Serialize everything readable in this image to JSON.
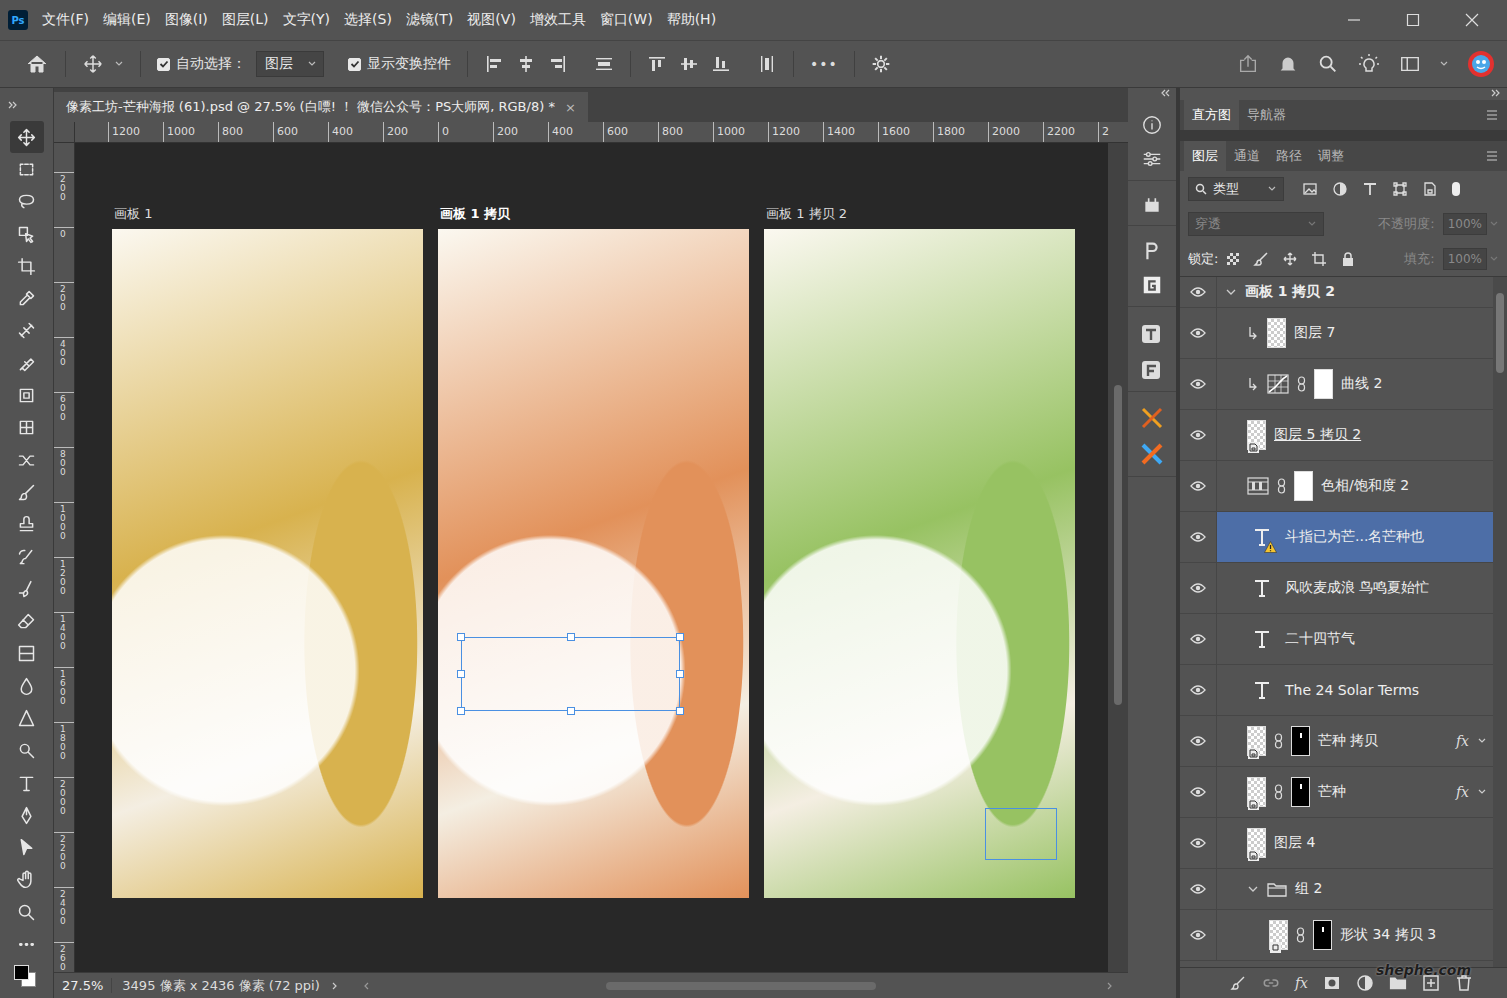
{
  "app": {
    "logo": "Ps"
  },
  "menu": [
    "文件(F)",
    "编辑(E)",
    "图像(I)",
    "图层(L)",
    "文字(Y)",
    "选择(S)",
    "滤镜(T)",
    "视图(V)",
    "增效工具",
    "窗口(W)",
    "帮助(H)"
  ],
  "options_bar": {
    "auto_select": {
      "label": "自动选择：",
      "checked": true
    },
    "target": "图层",
    "show_transform": {
      "label": "显示变换控件",
      "checked": true
    },
    "more": "•••"
  },
  "document_tab": {
    "title": "像素工坊-芒种海报 (61).psd @ 27.5% (白嘌! ！ 微信公众号：PS大师网, RGB/8) *",
    "close": "×"
  },
  "tools": [
    {
      "kind": "move",
      "selected": true
    },
    {
      "kind": "marquee",
      "selected": false
    },
    {
      "kind": "lasso",
      "selected": false
    },
    {
      "kind": "object-select",
      "selected": false
    },
    {
      "kind": "crop",
      "selected": false
    },
    {
      "kind": "eyedropper",
      "selected": false
    },
    {
      "kind": "spot-heal",
      "selected": false
    },
    {
      "kind": "heal",
      "selected": false
    },
    {
      "kind": "patch",
      "selected": false
    },
    {
      "kind": "pattern",
      "selected": false
    },
    {
      "kind": "content-move",
      "selected": false
    },
    {
      "kind": "brush",
      "selected": false
    },
    {
      "kind": "stamp",
      "selected": false
    },
    {
      "kind": "history-brush",
      "selected": false
    },
    {
      "kind": "mixer",
      "selected": false
    },
    {
      "kind": "eraser",
      "selected": false
    },
    {
      "kind": "gradient",
      "selected": false
    },
    {
      "kind": "blur",
      "selected": false
    },
    {
      "kind": "sharpen",
      "selected": false
    },
    {
      "kind": "dodge",
      "selected": false
    },
    {
      "kind": "type",
      "selected": false
    },
    {
      "kind": "pen",
      "selected": false
    },
    {
      "kind": "path-select",
      "selected": false
    },
    {
      "kind": "hand",
      "selected": false
    },
    {
      "kind": "zoom",
      "selected": false
    },
    {
      "kind": "more",
      "selected": false
    }
  ],
  "rulers": {
    "horizontal": [
      "1200",
      "1000",
      "800",
      "600",
      "400",
      "200",
      "0",
      "200",
      "400",
      "600",
      "800",
      "1000",
      "1200",
      "1400",
      "1600",
      "1800",
      "2000",
      "2200",
      "2"
    ],
    "vertical": [
      "200",
      "0",
      "200",
      "400",
      "600",
      "800",
      "1000",
      "1200",
      "1400",
      "1600",
      "1800",
      "2000",
      "2200",
      "2400",
      "260"
    ]
  },
  "artboards": [
    {
      "label": "画板 1",
      "active": false,
      "color": "#d8b24e",
      "overlay": "none"
    },
    {
      "label": "画板 1 拷贝",
      "active": true,
      "color": "#e2915a",
      "overlay": "transform"
    },
    {
      "label": "画板 1 拷贝 2",
      "active": false,
      "color": "#97c262",
      "overlay": "outline"
    }
  ],
  "status_bar": {
    "zoom": "27.5%",
    "info": "3495 像素 x 2436 像素 (72 ppi)"
  },
  "top_tabs": [
    {
      "label": "直方图",
      "selected": true
    },
    {
      "label": "导航器",
      "selected": false
    }
  ],
  "layer_tabs": [
    {
      "label": "图层",
      "selected": true
    },
    {
      "label": "通道",
      "selected": false
    },
    {
      "label": "路径",
      "selected": false
    },
    {
      "label": "调整",
      "selected": false
    }
  ],
  "layers_panel": {
    "filter": "类型",
    "blend_mode": "穿透",
    "opacity_label": "不透明度:",
    "opacity": "100%",
    "lock_label": "锁定:",
    "fill_label": "填充:",
    "fill": "100%",
    "disabled": true,
    "fx_label": "fx"
  },
  "layers": [
    {
      "name": "画板 1 拷贝 2",
      "kind": "artboard",
      "depth": 0,
      "expanded": true,
      "clipped": false,
      "mask": "none",
      "fx": "",
      "selected": false,
      "visible": true,
      "warning": false,
      "underlined": false
    },
    {
      "name": "图层 7",
      "kind": "pixel",
      "depth": 1,
      "expanded": false,
      "clipped": true,
      "mask": "none",
      "fx": "",
      "selected": false,
      "visible": true,
      "warning": false,
      "underlined": false
    },
    {
      "name": "曲线 2",
      "kind": "curves",
      "depth": 1,
      "expanded": false,
      "clipped": true,
      "mask": "white",
      "fx": "",
      "selected": false,
      "visible": true,
      "warning": false,
      "underlined": false
    },
    {
      "name": "图层 5 拷贝 2",
      "kind": "smart",
      "depth": 1,
      "expanded": false,
      "clipped": false,
      "mask": "none",
      "fx": "",
      "selected": false,
      "visible": true,
      "warning": false,
      "underlined": true
    },
    {
      "name": "色相/饱和度 2",
      "kind": "huesat",
      "depth": 1,
      "expanded": false,
      "clipped": false,
      "mask": "white",
      "fx": "",
      "selected": false,
      "visible": true,
      "warning": false,
      "underlined": false
    },
    {
      "name": "斗指已为芒...名芒种也",
      "kind": "text",
      "depth": 1,
      "expanded": false,
      "clipped": false,
      "mask": "none",
      "fx": "",
      "selected": true,
      "visible": true,
      "warning": true,
      "underlined": false
    },
    {
      "name": "风吹麦成浪 鸟鸣夏始忙",
      "kind": "text",
      "depth": 1,
      "expanded": false,
      "clipped": false,
      "mask": "none",
      "fx": "",
      "selected": false,
      "visible": true,
      "warning": false,
      "underlined": false
    },
    {
      "name": "二十四节气",
      "kind": "text",
      "depth": 1,
      "expanded": false,
      "clipped": false,
      "mask": "none",
      "fx": "",
      "selected": false,
      "visible": true,
      "warning": false,
      "underlined": false
    },
    {
      "name": "The 24 Solar Terms",
      "kind": "text",
      "depth": 1,
      "expanded": false,
      "clipped": false,
      "mask": "none",
      "fx": "",
      "selected": false,
      "visible": true,
      "warning": false,
      "underlined": false
    },
    {
      "name": "芒种 拷贝",
      "kind": "smart",
      "depth": 1,
      "expanded": false,
      "clipped": false,
      "mask": "black",
      "fx": "fx",
      "selected": false,
      "visible": true,
      "warning": false,
      "underlined": false
    },
    {
      "name": "芒种",
      "kind": "smart",
      "depth": 1,
      "expanded": false,
      "clipped": false,
      "mask": "black",
      "fx": "fx",
      "selected": false,
      "visible": true,
      "warning": false,
      "underlined": false
    },
    {
      "name": "图层 4",
      "kind": "smart",
      "depth": 1,
      "expanded": false,
      "clipped": false,
      "mask": "none",
      "fx": "",
      "selected": false,
      "visible": true,
      "warning": false,
      "underlined": false
    },
    {
      "name": "组 2",
      "kind": "group",
      "depth": 1,
      "expanded": true,
      "clipped": false,
      "mask": "none",
      "fx": "",
      "selected": false,
      "visible": true,
      "warning": false,
      "underlined": false
    },
    {
      "name": "形状 34 拷贝 3",
      "kind": "shape",
      "depth": 2,
      "expanded": false,
      "clipped": false,
      "mask": "black",
      "fx": "",
      "selected": false,
      "visible": true,
      "warning": false,
      "underlined": false
    }
  ],
  "watermark": "shephe.com"
}
